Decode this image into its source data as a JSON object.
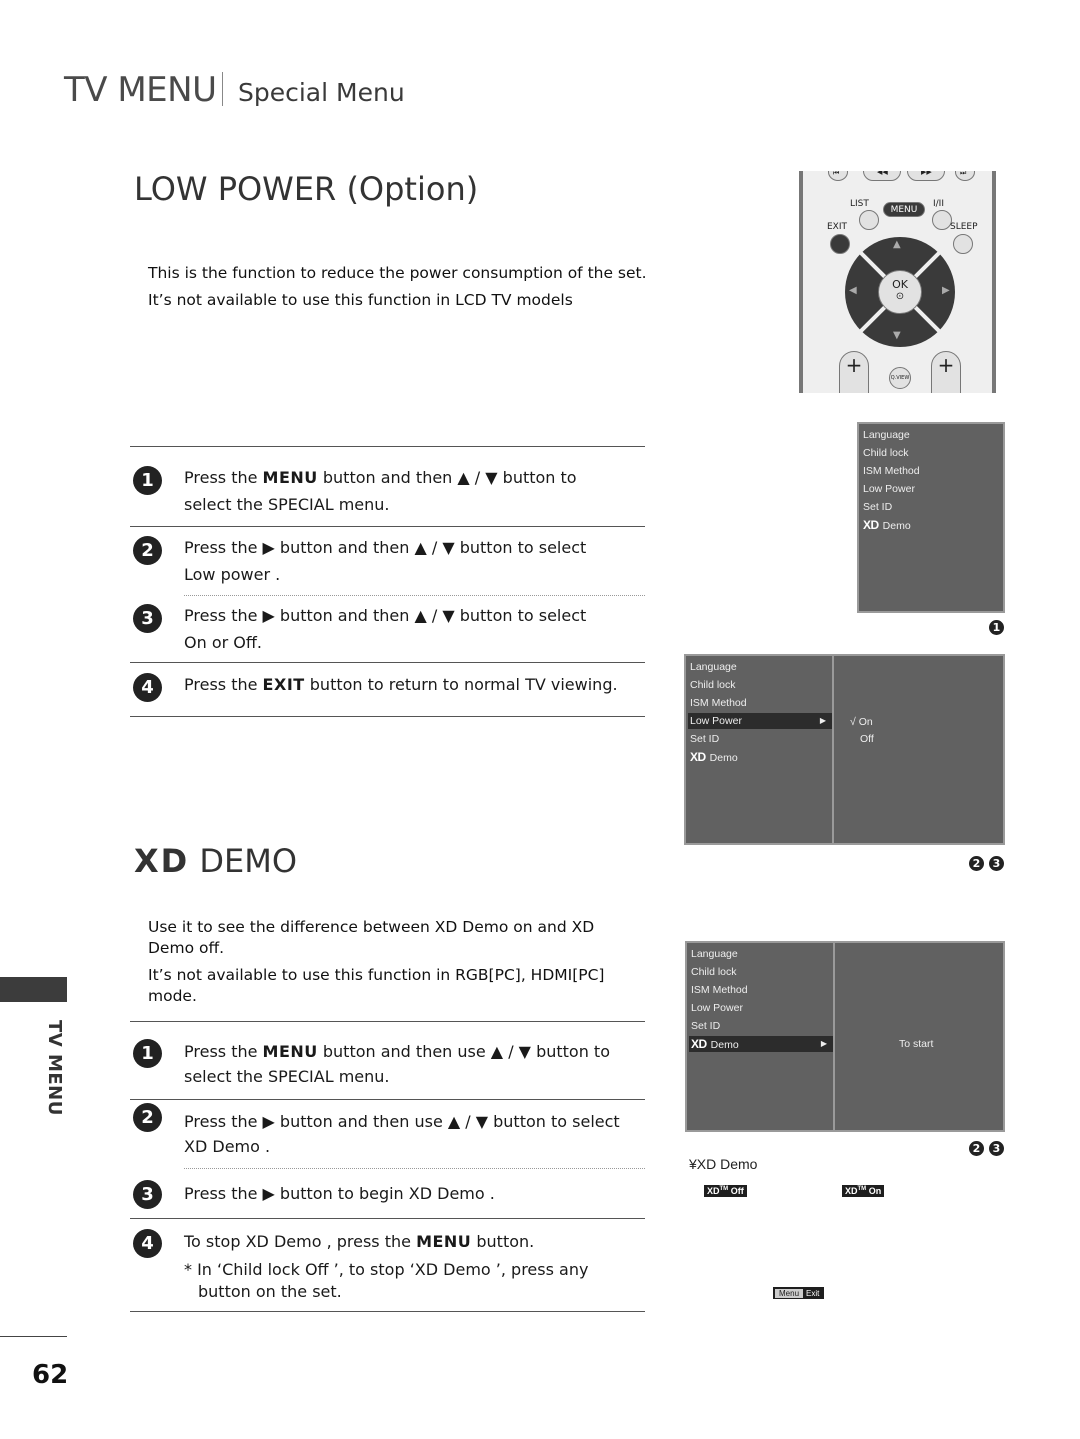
{
  "header": {
    "section": "TV MENU",
    "subsection": "Special Menu"
  },
  "low_power": {
    "title": "LOW POWER (Option)",
    "intro": [
      "This is the function to reduce the power consumption of the set.",
      "It’s not available to use this function in  LCD TV models"
    ],
    "steps": [
      {
        "num": "1",
        "pre": "Press the ",
        "bold": "MENU",
        "post": " button and then ▲ / ▼ button to",
        "line2": "select the SPECIAL menu."
      },
      {
        "num": "2",
        "pre": "Press the ▶ button and then ▲ / ▼ button to select",
        "line2": "Low power  ."
      },
      {
        "num": "3",
        "pre": "Press the ▶ button and then ▲ / ▼ button to select",
        "line2": "On or Off."
      },
      {
        "num": "4",
        "pre": "Press the ",
        "bold": "EXIT",
        "post": " button to return to normal TV viewing."
      }
    ]
  },
  "xd_demo": {
    "title_bold": "XD",
    "title_rest": " DEMO",
    "intro": [
      "Use it to see the difference between XD Demo on and XD Demo off.",
      "It’s not available to use this function in RGB[PC], HDMI[PC] mode."
    ],
    "steps": [
      {
        "num": "1",
        "pre": "Press the ",
        "bold": "MENU",
        "post": " button and then use ▲ / ▼ button to",
        "line2": "select the SPECIAL menu."
      },
      {
        "num": "2",
        "pre": "Press the ▶ button and then use ▲ / ▼ button to select",
        "line2": "XD Demo ."
      },
      {
        "num": "3",
        "pre": "Press the ▶ button to begin XD Demo ."
      },
      {
        "num": "4",
        "pre": "To stop XD Demo , press the ",
        "bold": "MENU",
        "post": " button."
      }
    ],
    "note_line1": "* In ‘Child lock Off   ’,  to stop ‘XD Demo ’, press any",
    "note_line2": "button on the set."
  },
  "remote": {
    "list": "LIST",
    "menu": "MENU",
    "i_ii": "I/II",
    "exit": "EXIT",
    "sleep": "SLEEP",
    "ok": "OK",
    "qview": "Q.VIEW",
    "plus": "+"
  },
  "menu_items": [
    "Language",
    "Child lock",
    "ISM Method",
    "Low Power",
    "Set ID",
    "Demo"
  ],
  "xd_logo": "XD",
  "screen1": {
    "badge": "1"
  },
  "screen2": {
    "selected": "Low Power",
    "options": [
      "On",
      "Off"
    ],
    "checked": "On",
    "check_mark": "√",
    "badges": [
      "2",
      "3"
    ]
  },
  "screen3": {
    "selected": "Demo",
    "right_text": "To start",
    "badges": [
      "2",
      "3"
    ]
  },
  "demo_caption": "¥XD Demo",
  "demo_labels": {
    "off": "Off",
    "on": "On",
    "xd": "XD",
    "tm": "TM"
  },
  "menu_exit": {
    "menu": "Menu",
    "exit": "Exit"
  },
  "sidebar": {
    "label": "TV MENU"
  },
  "page_number": "62"
}
